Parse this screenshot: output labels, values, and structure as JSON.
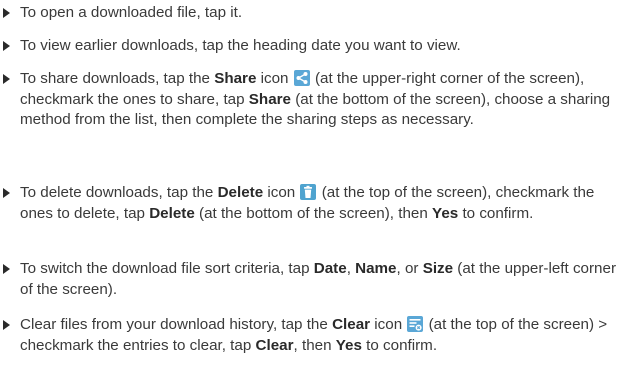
{
  "items": [
    {
      "text": "To open a downloaded file, tap it."
    },
    {
      "text": "To view earlier downloads, tap the heading date you want to view."
    },
    {
      "t1": "To share downloads, tap the ",
      "b1": "Share",
      "t2": " icon ",
      "t3": " (at the upper-right corner of the screen), checkmark the ones to share, tap ",
      "b2": "Share",
      "t4": " (at the bottom of the screen), choose a sharing method from the list, then complete the sharing steps as necessary."
    },
    {
      "t1": "To delete downloads, tap the ",
      "b1": "Delete",
      "t2": " icon ",
      "t3": " (at the top of the screen), checkmark the ones to delete, tap ",
      "b2": "Delete",
      "t4": " (at the bottom of the screen), then ",
      "b3": "Yes",
      "t5": " to confirm."
    },
    {
      "t1": "To switch the download file sort criteria, tap ",
      "b1": "Date",
      "t2": ", ",
      "b2": "Name",
      "t3": ", or ",
      "b3": "Size",
      "t4": " (at the upper-left corner of the screen)."
    },
    {
      "t1": "Clear files from your download history, tap the ",
      "b1": "Clear",
      "t2": " icon ",
      "t3": " (at the top of the screen) > checkmark the entries to clear, tap ",
      "b2": "Clear",
      "t4": ", then ",
      "b3": "Yes",
      "t5": " to confirm."
    }
  ],
  "icons": {
    "share": "share-icon",
    "delete": "trash-icon",
    "clear": "clear-history-icon"
  }
}
